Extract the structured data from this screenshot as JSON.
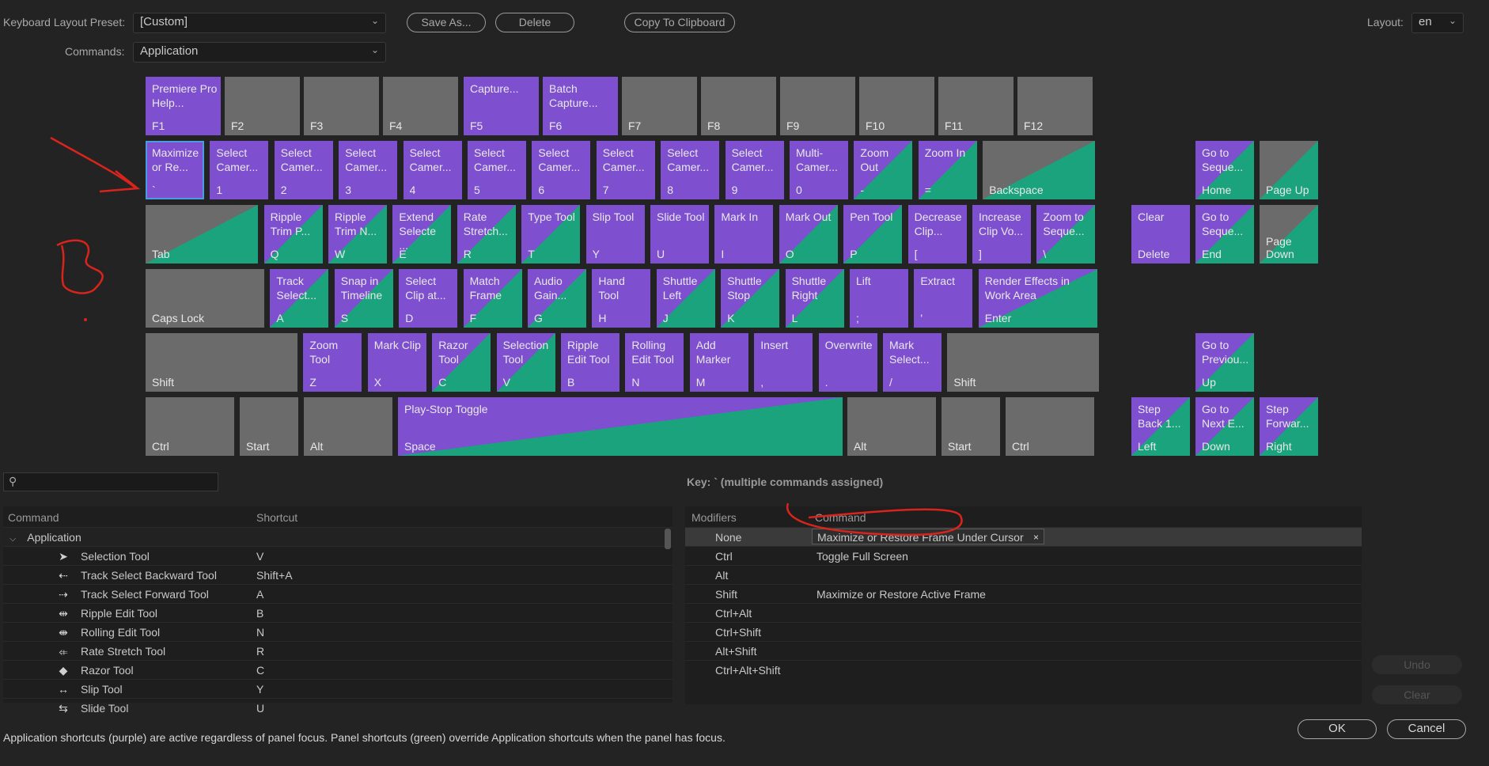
{
  "header": {
    "preset_label": "Keyboard Layout Preset:",
    "preset_value": "[Custom]",
    "save_as": "Save As...",
    "delete": "Delete",
    "copy_clipboard": "Copy To Clipboard",
    "layout_label": "Layout:",
    "layout_value": "en",
    "commands_label": "Commands:",
    "commands_value": "Application"
  },
  "keyboard": {
    "fkeys": [
      {
        "cap": "F1",
        "cmd": "Premiere Pro Help...",
        "color": "purple"
      },
      {
        "cap": "F2",
        "cmd": "",
        "color": "gray"
      },
      {
        "cap": "F3",
        "cmd": "",
        "color": "gray"
      },
      {
        "cap": "F4",
        "cmd": "",
        "color": "gray"
      },
      {
        "cap": "F5",
        "cmd": "Capture...",
        "color": "purple"
      },
      {
        "cap": "F6",
        "cmd": "Batch Capture...",
        "color": "purple"
      },
      {
        "cap": "F7",
        "cmd": "",
        "color": "gray"
      },
      {
        "cap": "F8",
        "cmd": "",
        "color": "gray"
      },
      {
        "cap": "F9",
        "cmd": "",
        "color": "gray"
      },
      {
        "cap": "F10",
        "cmd": "",
        "color": "gray"
      },
      {
        "cap": "F11",
        "cmd": "",
        "color": "gray"
      },
      {
        "cap": "F12",
        "cmd": "",
        "color": "gray"
      }
    ],
    "row1": [
      {
        "cap": "`",
        "cmd": "Maximize or Re...",
        "color": "purple",
        "selected": true
      },
      {
        "cap": "1",
        "cmd": "Select Camer...",
        "color": "purple"
      },
      {
        "cap": "2",
        "cmd": "Select Camer...",
        "color": "purple"
      },
      {
        "cap": "3",
        "cmd": "Select Camer...",
        "color": "purple"
      },
      {
        "cap": "4",
        "cmd": "Select Camer...",
        "color": "purple"
      },
      {
        "cap": "5",
        "cmd": "Select Camer...",
        "color": "purple"
      },
      {
        "cap": "6",
        "cmd": "Select Camer...",
        "color": "purple"
      },
      {
        "cap": "7",
        "cmd": "Select Camer...",
        "color": "purple"
      },
      {
        "cap": "8",
        "cmd": "Select Camer...",
        "color": "purple"
      },
      {
        "cap": "9",
        "cmd": "Select Camer...",
        "color": "purple"
      },
      {
        "cap": "0",
        "cmd": "Multi-Camer...",
        "color": "purple"
      },
      {
        "cap": "-",
        "cmd": "Zoom Out",
        "color": "pg"
      },
      {
        "cap": "=",
        "cmd": "Zoom In",
        "color": "pg"
      },
      {
        "cap": "Backspace",
        "cmd": "",
        "color": "gg"
      }
    ],
    "row2": [
      {
        "cap": "Tab",
        "cmd": "",
        "color": "gg"
      },
      {
        "cap": "Q",
        "cmd": "Ripple Trim P...",
        "color": "pg"
      },
      {
        "cap": "W",
        "cmd": "Ripple Trim N...",
        "color": "pg"
      },
      {
        "cap": "E",
        "cmd": "Extend Selecte ...",
        "color": "pg"
      },
      {
        "cap": "R",
        "cmd": "Rate Stretch...",
        "color": "pg"
      },
      {
        "cap": "T",
        "cmd": "Type Tool",
        "color": "pg"
      },
      {
        "cap": "Y",
        "cmd": "Slip Tool",
        "color": "purple"
      },
      {
        "cap": "U",
        "cmd": "Slide Tool",
        "color": "purple"
      },
      {
        "cap": "I",
        "cmd": "Mark In",
        "color": "purple"
      },
      {
        "cap": "O",
        "cmd": "Mark Out",
        "color": "pg"
      },
      {
        "cap": "P",
        "cmd": "Pen Tool",
        "color": "pg"
      },
      {
        "cap": "[",
        "cmd": "Decrease Clip...",
        "color": "purple"
      },
      {
        "cap": "]",
        "cmd": "Increase Clip Vo...",
        "color": "purple"
      },
      {
        "cap": "\\",
        "cmd": "Zoom to Seque...",
        "color": "pg"
      }
    ],
    "row3": [
      {
        "cap": "Caps Lock",
        "cmd": "",
        "color": "gray"
      },
      {
        "cap": "A",
        "cmd": "Track Select...",
        "color": "pg"
      },
      {
        "cap": "S",
        "cmd": "Snap in Timeline",
        "color": "pg"
      },
      {
        "cap": "D",
        "cmd": "Select Clip at...",
        "color": "purple"
      },
      {
        "cap": "F",
        "cmd": "Match Frame",
        "color": "pg"
      },
      {
        "cap": "G",
        "cmd": "Audio Gain...",
        "color": "pg"
      },
      {
        "cap": "H",
        "cmd": "Hand Tool",
        "color": "purple"
      },
      {
        "cap": "J",
        "cmd": "Shuttle Left",
        "color": "pg"
      },
      {
        "cap": "K",
        "cmd": "Shuttle Stop",
        "color": "pg"
      },
      {
        "cap": "L",
        "cmd": "Shuttle Right",
        "color": "pg"
      },
      {
        "cap": ";",
        "cmd": "Lift",
        "color": "purple"
      },
      {
        "cap": "'",
        "cmd": "Extract",
        "color": "purple"
      },
      {
        "cap": "Enter",
        "cmd": "Render Effects in Work Area",
        "color": "pg"
      }
    ],
    "row4": [
      {
        "cap": "Shift",
        "cmd": "",
        "color": "gray"
      },
      {
        "cap": "Z",
        "cmd": "Zoom Tool",
        "color": "purple"
      },
      {
        "cap": "X",
        "cmd": "Mark Clip",
        "color": "purple"
      },
      {
        "cap": "C",
        "cmd": "Razor Tool",
        "color": "pg"
      },
      {
        "cap": "V",
        "cmd": "Selection Tool",
        "color": "pg"
      },
      {
        "cap": "B",
        "cmd": "Ripple Edit Tool",
        "color": "purple"
      },
      {
        "cap": "N",
        "cmd": "Rolling Edit Tool",
        "color": "purple"
      },
      {
        "cap": "M",
        "cmd": "Add Marker",
        "color": "purple"
      },
      {
        "cap": ",",
        "cmd": "Insert",
        "color": "purple"
      },
      {
        "cap": ".",
        "cmd": "Overwrite",
        "color": "purple"
      },
      {
        "cap": "/",
        "cmd": "Mark Select...",
        "color": "purple"
      },
      {
        "cap": "Shift",
        "cmd": "",
        "color": "gray"
      }
    ],
    "row5": [
      {
        "cap": "Ctrl",
        "cmd": "",
        "color": "gray"
      },
      {
        "cap": "Start",
        "cmd": "",
        "color": "gray"
      },
      {
        "cap": "Alt",
        "cmd": "",
        "color": "gray"
      },
      {
        "cap": "Space",
        "cmd": "Play-Stop Toggle",
        "color": "pg"
      },
      {
        "cap": "Alt",
        "cmd": "",
        "color": "gray"
      },
      {
        "cap": "Start",
        "cmd": "",
        "color": "gray"
      },
      {
        "cap": "Ctrl",
        "cmd": "",
        "color": "gray"
      }
    ],
    "nav": [
      {
        "cap": "Home",
        "cmd": "Go to Seque...",
        "color": "pg"
      },
      {
        "cap": "Page Up",
        "cmd": "",
        "color": "gg"
      },
      {
        "cap": "Delete",
        "cmd": "Clear",
        "color": "purple"
      },
      {
        "cap": "End",
        "cmd": "Go to Seque...",
        "color": "pg"
      },
      {
        "cap": "Page Down",
        "cmd": "",
        "color": "gg"
      },
      {
        "cap": "Up",
        "cmd": "Go to Previou...",
        "color": "pg"
      },
      {
        "cap": "Left",
        "cmd": "Step Back 1...",
        "color": "pg"
      },
      {
        "cap": "Down",
        "cmd": "Go to Next E...",
        "color": "pg"
      },
      {
        "cap": "Right",
        "cmd": "Step Forwar...",
        "color": "pg"
      }
    ]
  },
  "key_info": "Key:  ` (multiple commands assigned)",
  "command_list": {
    "col_command": "Command",
    "col_shortcut": "Shortcut",
    "group": "Application",
    "rows": [
      {
        "icon": "selection-tool-icon",
        "glyph": "➤",
        "name": "Selection Tool",
        "shortcut": "V"
      },
      {
        "icon": "track-select-backward-icon",
        "glyph": "⇠",
        "name": "Track Select Backward Tool",
        "shortcut": "Shift+A"
      },
      {
        "icon": "track-select-forward-icon",
        "glyph": "⇢",
        "name": "Track Select Forward Tool",
        "shortcut": "A"
      },
      {
        "icon": "ripple-edit-icon",
        "glyph": "⇹",
        "name": "Ripple Edit Tool",
        "shortcut": "B"
      },
      {
        "icon": "rolling-edit-icon",
        "glyph": "⇼",
        "name": "Rolling Edit Tool",
        "shortcut": "N"
      },
      {
        "icon": "rate-stretch-icon",
        "glyph": "⤂",
        "name": "Rate Stretch Tool",
        "shortcut": "R"
      },
      {
        "icon": "razor-icon",
        "glyph": "◆",
        "name": "Razor Tool",
        "shortcut": "C"
      },
      {
        "icon": "slip-tool-icon",
        "glyph": "↔",
        "name": "Slip Tool",
        "shortcut": "Y"
      },
      {
        "icon": "slide-tool-icon",
        "glyph": "⇆",
        "name": "Slide Tool",
        "shortcut": "U"
      }
    ]
  },
  "modifiers": {
    "col_modifiers": "Modifiers",
    "col_command": "Command",
    "rows": [
      {
        "mod": "None",
        "cmd": "Maximize or Restore Frame Under Cursor"
      },
      {
        "mod": "Ctrl",
        "cmd": "Toggle Full Screen"
      },
      {
        "mod": "Alt",
        "cmd": ""
      },
      {
        "mod": "Shift",
        "cmd": "Maximize or Restore Active Frame"
      },
      {
        "mod": "Ctrl+Alt",
        "cmd": ""
      },
      {
        "mod": "Ctrl+Shift",
        "cmd": ""
      },
      {
        "mod": "Alt+Shift",
        "cmd": ""
      },
      {
        "mod": "Ctrl+Alt+Shift",
        "cmd": ""
      }
    ]
  },
  "side_buttons": {
    "undo": "Undo",
    "clear": "Clear"
  },
  "footer": {
    "note": "Application shortcuts (purple) are  active  regardless  of panel focus.  Panel  shortcuts  (green)  override  Application shortcuts when the panel has focus.",
    "ok": "OK",
    "cancel": "Cancel"
  },
  "colors": {
    "purple": "#7e4fcf",
    "green": "#1aa37d",
    "gray": "#6b6b6b",
    "annotation": "#d8241c"
  }
}
